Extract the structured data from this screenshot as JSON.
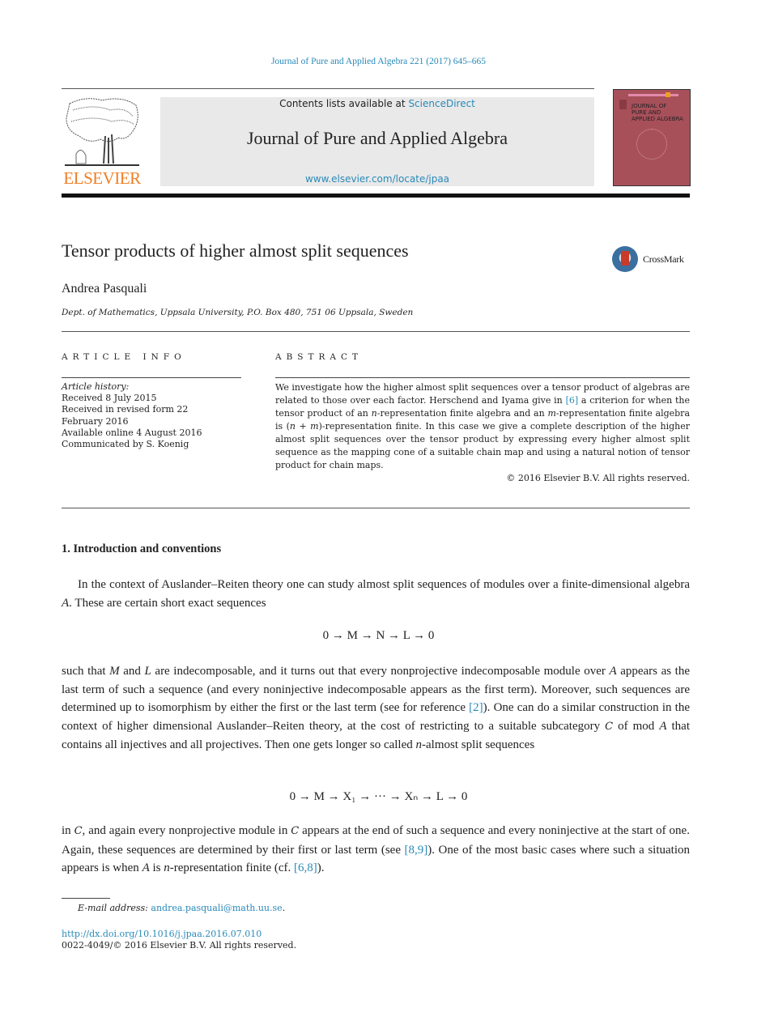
{
  "header": {
    "journal_ref": "Journal of Pure and Applied Algebra 221 (2017) 645–665",
    "contents_prefix": "Contents lists available at ",
    "contents_link": "ScienceDirect",
    "journal_title": "Journal of Pure and Applied Algebra",
    "journal_url": "www.elsevier.com/locate/jpaa",
    "publisher_logo_text": "ELSEVIER",
    "cover_title_lines": [
      "JOURNAL OF",
      "PURE AND",
      "APPLIED ALGEBRA"
    ]
  },
  "article": {
    "title": "Tensor products of higher almost split sequences",
    "crossmark_label": "CrossMark",
    "author": "Andrea Pasquali",
    "affiliation": "Dept. of Mathematics, Uppsala University, P.O. Box 480, 751 06 Uppsala, Sweden"
  },
  "article_info": {
    "label": "ARTICLE INFO",
    "history_heading": "Article history:",
    "history": [
      "Received 8 July 2015",
      "Received in revised form 22",
      "February 2016",
      "Available online 4 August 2016",
      "Communicated by S. Koenig"
    ]
  },
  "abstract": {
    "label": "ABSTRACT",
    "text_1": "We investigate how the higher almost split sequences over a tensor product of algebras are related to those over each factor. Herschend and Iyama give in ",
    "ref_1": "[6]",
    "text_2": " a criterion for when the tensor product of an ",
    "var_n": "n",
    "text_3": "-representation finite algebra and an ",
    "var_m": "m",
    "text_4": "-representation finite algebra is (",
    "expr_nm": "n + m",
    "text_5": ")-representation finite. In this case we give a complete description of the higher almost split sequences over the tensor product by expressing every higher almost split sequence as the mapping cone of a suitable chain map and using a natural notion of tensor product for chain maps.",
    "copyright": "© 2016 Elsevier B.V. All rights reserved."
  },
  "section1": {
    "heading": "1.  Introduction and conventions",
    "p1_a": "In the context of Auslander–Reiten theory one can study almost split sequences of modules over a finite-dimensional algebra ",
    "p1_var": "A",
    "p1_b": ". These are certain short exact sequences",
    "eq1": "0 → M → N → L → 0",
    "p2_a": "such that ",
    "p2_M": "M",
    "p2_b": " and ",
    "p2_L": "L",
    "p2_c": " are indecomposable, and it turns out that every nonprojective indecomposable module over ",
    "p2_A": "A",
    "p2_d": " appears as the last term of such a sequence (and every noninjective indecomposable appears as the first term). Moreover, such sequences are determined up to isomorphism by either the first or the last term (see for reference ",
    "p2_ref": "[2]",
    "p2_e": "). One can do a similar construction in the context of higher dimensional Auslander–Reiten theory, at the cost of restricting to a suitable subcategory ",
    "p2_C": "C",
    "p2_f": " of mod ",
    "p2_A2": "A",
    "p2_g": " that contains all injectives and all projectives. Then one gets longer so called ",
    "p2_n": "n",
    "p2_h": "-almost split sequences",
    "eq2": "0 → M → X₁ → ··· → Xₙ → L → 0",
    "p3_a": "in ",
    "p3_C": "C",
    "p3_b": ", and again every nonprojective module in ",
    "p3_C2": "C",
    "p3_c": " appears at the end of such a sequence and every noninjective at the start of one. Again, these sequences are determined by their first or last term (see ",
    "p3_ref1": "[8,9]",
    "p3_d": "). One of the most basic cases where such a situation appears is when ",
    "p3_A": "A",
    "p3_e": " is ",
    "p3_n": "n",
    "p3_f": "-representation finite (cf. ",
    "p3_ref2": "[6,8]",
    "p3_g": ")."
  },
  "footer": {
    "email_label": "E-mail address:",
    "email": "andrea.pasquali@math.uu.se",
    "email_suffix": ".",
    "doi": "http://dx.doi.org/10.1016/j.jpaa.2016.07.010",
    "issn_line": "0022-4049/© 2016 Elsevier B.V. All rights reserved."
  },
  "colors": {
    "link": "#2a8ab8",
    "elsevier_orange": "#f07e26",
    "cover": "#a8505a",
    "masthead_bg": "#e9e9e9"
  }
}
